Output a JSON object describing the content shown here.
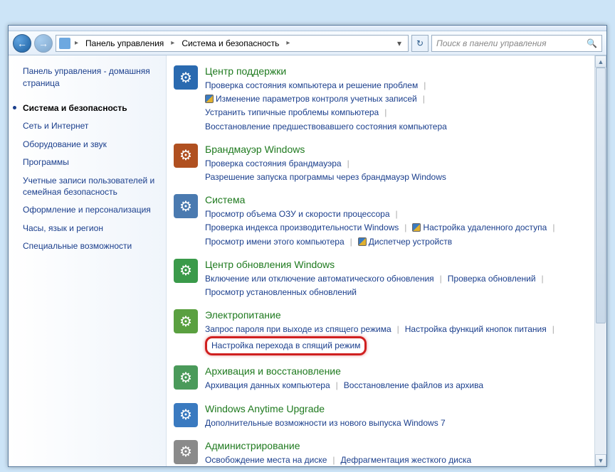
{
  "breadcrumb": {
    "root": "Панель управления",
    "current": "Система и безопасность"
  },
  "search": {
    "placeholder": "Поиск в панели управления"
  },
  "sidebar": {
    "home": "Панель управления - домашняя страница",
    "items": [
      "Система и безопасность",
      "Сеть и Интернет",
      "Оборудование и звук",
      "Программы",
      "Учетные записи пользователей и семейная безопасность",
      "Оформление и персонализация",
      "Часы, язык и регион",
      "Специальные возможности"
    ]
  },
  "categories": [
    {
      "title": "Центр поддержки",
      "icon_bg": "#2a6ab0",
      "links": [
        {
          "text": "Проверка состояния компьютера и решение проблем"
        },
        {
          "text": "Изменение параметров контроля учетных записей",
          "shield": true
        },
        {
          "text": "Устранить типичные проблемы компьютера"
        },
        {
          "text": "Восстановление предшествовавшего состояния компьютера"
        }
      ]
    },
    {
      "title": "Брандмауэр Windows",
      "icon_bg": "#b05020",
      "links": [
        {
          "text": "Проверка состояния брандмауэра"
        },
        {
          "text": "Разрешение запуска программы через брандмауэр Windows"
        }
      ]
    },
    {
      "title": "Система",
      "icon_bg": "#4a7ab0",
      "links": [
        {
          "text": "Просмотр объема ОЗУ и скорости процессора"
        },
        {
          "text": "Проверка индекса производительности Windows"
        },
        {
          "text": "Настройка удаленного доступа",
          "shield": true
        },
        {
          "text": "Просмотр имени этого компьютера"
        },
        {
          "text": "Диспетчер устройств",
          "shield": true
        }
      ]
    },
    {
      "title": "Центр обновления Windows",
      "icon_bg": "#3a9a4a",
      "links": [
        {
          "text": "Включение или отключение автоматического обновления"
        },
        {
          "text": "Проверка обновлений"
        },
        {
          "text": "Просмотр установленных обновлений"
        }
      ]
    },
    {
      "title": "Электропитание",
      "icon_bg": "#5aa040",
      "links": [
        {
          "text": "Запрос пароля при выходе из спящего режима"
        },
        {
          "text": "Настройка функций кнопок питания"
        },
        {
          "text": "Настройка перехода в спящий режим",
          "highlight": true
        }
      ]
    },
    {
      "title": "Архивация и восстановление",
      "icon_bg": "#4a9a5a",
      "links": [
        {
          "text": "Архивация данных компьютера"
        },
        {
          "text": "Восстановление файлов из архива"
        }
      ]
    },
    {
      "title": "Windows Anytime Upgrade",
      "icon_bg": "#3a7ac0",
      "links": [
        {
          "text": "Дополнительные возможности из нового выпуска Windows 7"
        }
      ]
    },
    {
      "title": "Администрирование",
      "icon_bg": "#8a8a8a",
      "links": [
        {
          "text": "Освобождение места на диске"
        },
        {
          "text": "Дефрагментация жесткого диска"
        }
      ]
    }
  ]
}
